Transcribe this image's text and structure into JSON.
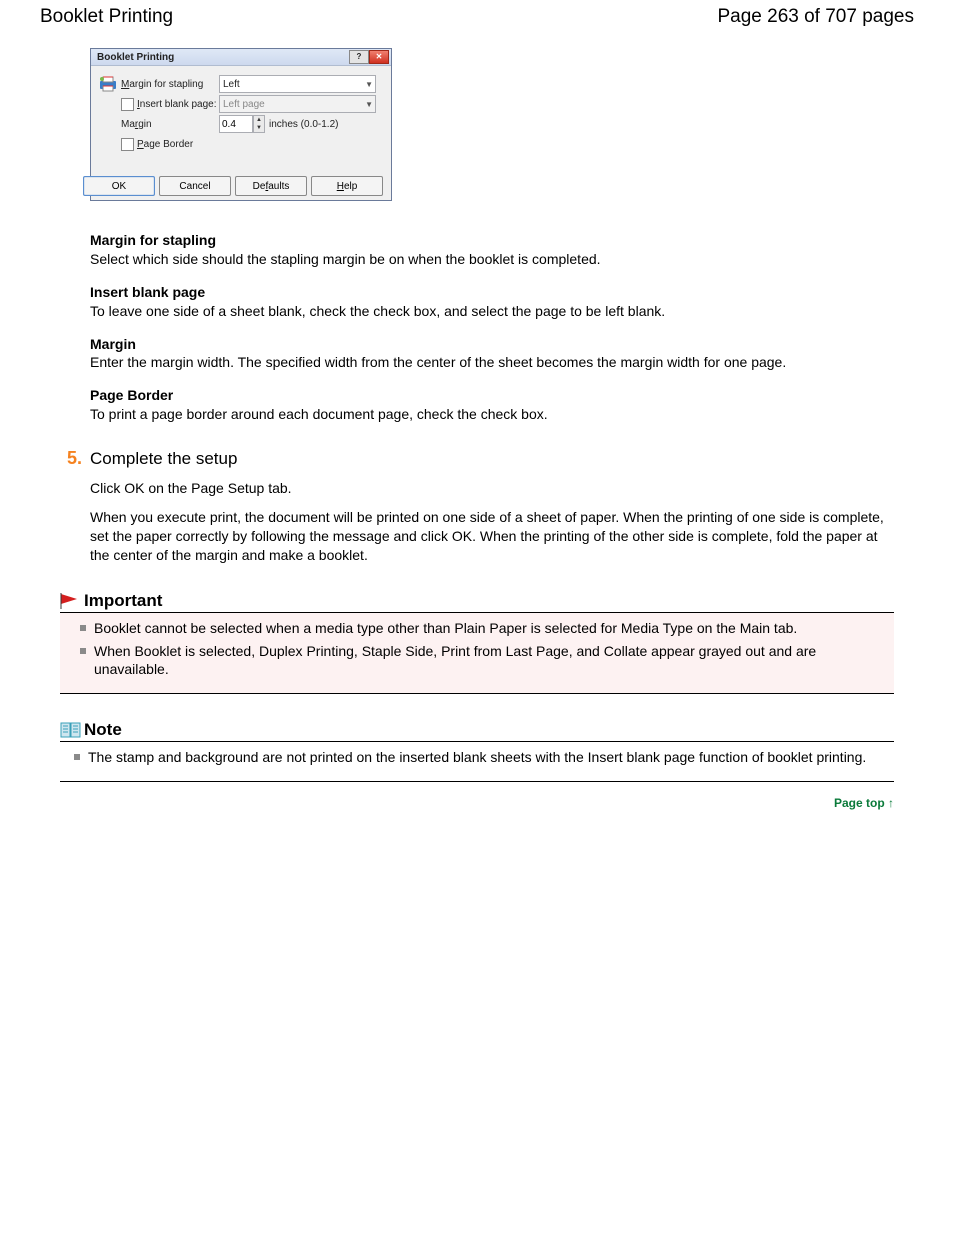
{
  "header": {
    "title": "Booklet Printing",
    "page_info": "Page 263 of 707 pages"
  },
  "dialog": {
    "title": "Booklet Printing",
    "labels": {
      "margin_stapling": "Margin for stapling",
      "insert_blank": "Insert blank page:",
      "margin": "Margin",
      "page_border": "Page Border"
    },
    "values": {
      "side": "Left",
      "blank_page": "Left page",
      "margin_value": "0.4",
      "margin_unit": "inches (0.0-1.2)"
    },
    "buttons": {
      "ok": "OK",
      "cancel": "Cancel",
      "defaults": "Defaults",
      "help": "Help"
    }
  },
  "definitions": {
    "margin_stapling": {
      "term": "Margin for stapling",
      "desc": "Select which side should the stapling margin be on when the booklet is completed."
    },
    "insert_blank": {
      "term": "Insert blank page",
      "desc": "To leave one side of a sheet blank, check the check box, and select the page to be left blank."
    },
    "margin": {
      "term": "Margin",
      "desc": "Enter the margin width. The specified width from the center of the sheet becomes the margin width for one page."
    },
    "page_border": {
      "term": "Page Border",
      "desc": "To print a page border around each document page, check the check box."
    }
  },
  "step": {
    "number": "5.",
    "title": "Complete the setup",
    "p1": "Click OK on the Page Setup tab.",
    "p2": "When you execute print, the document will be printed on one side of a sheet of paper. When the printing of one side is complete, set the paper correctly by following the message and click OK. When the printing of the other side is complete, fold the paper at the center of the margin and make a booklet."
  },
  "important": {
    "title": "Important",
    "items": [
      "Booklet cannot be selected when a media type other than Plain Paper is selected for Media Type on the Main tab.",
      "When Booklet is selected, Duplex Printing, Staple Side, Print from Last Page, and Collate appear grayed out and are unavailable."
    ]
  },
  "note": {
    "title": "Note",
    "items": [
      "The stamp and background are not printed on the inserted blank sheets with the Insert blank page function of booklet printing."
    ]
  },
  "pagetop": {
    "label": "Page top"
  }
}
